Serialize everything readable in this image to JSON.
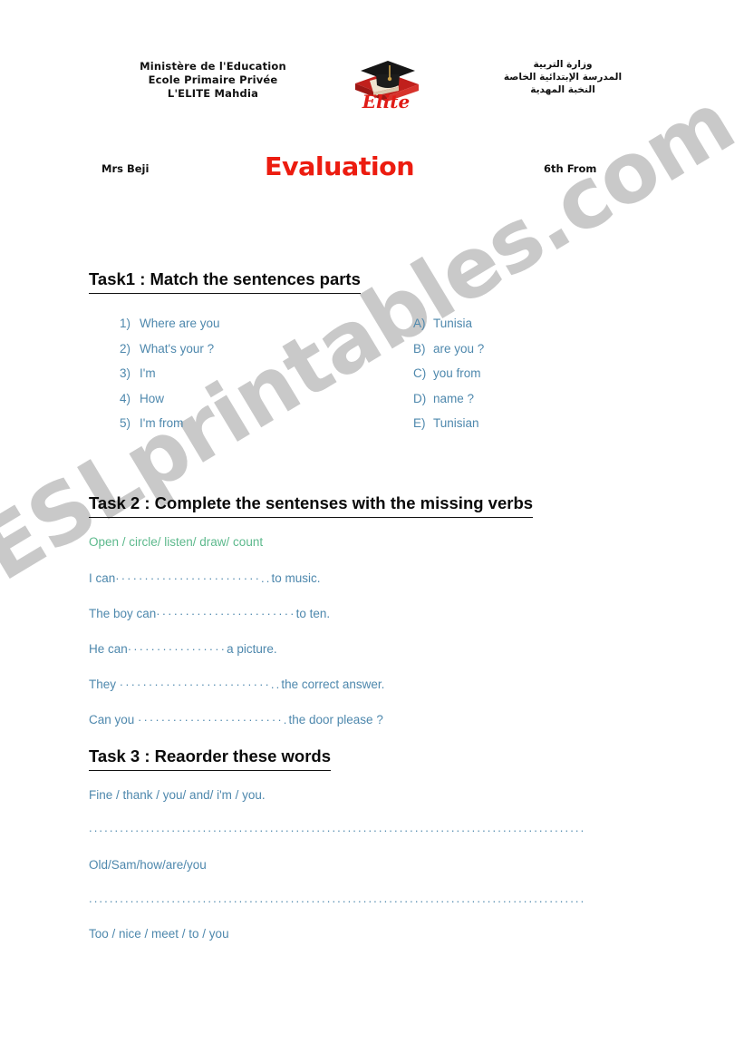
{
  "header": {
    "school_fr_lines": [
      "Ministère de l'Education",
      "Ecole Primaire Privée",
      "L'ELITE  Mahdia"
    ],
    "school_ar_lines": [
      "وزارة التربية",
      "المدرسة الإبتدائية الخاصة",
      "النخبة المهدية"
    ],
    "logo_text": "Elite",
    "logo_name": "elite-graduation-cap-logo"
  },
  "title_row": {
    "teacher": "Mrs Beji",
    "title": "Evaluation",
    "form": "6th From"
  },
  "task1": {
    "heading": "Task1 : Match the sentences parts",
    "left_items": [
      {
        "marker": "1)",
        "text": "Where are you"
      },
      {
        "marker": "2)",
        "text": "What's your ?"
      },
      {
        "marker": "3)",
        "text": "I'm"
      },
      {
        "marker": "4)",
        "text": "How"
      },
      {
        "marker": "5)",
        "text": "I'm from"
      }
    ],
    "right_items": [
      {
        "marker": "A)",
        "text": "Tunisia"
      },
      {
        "marker": "B)",
        "text": "are you ?"
      },
      {
        "marker": "C)",
        "text": "you from"
      },
      {
        "marker": "D)",
        "text": "name ?"
      },
      {
        "marker": "E)",
        "text": "Tunisian"
      }
    ]
  },
  "task2": {
    "heading": "Task 2 : Complete the sentenses with the missing verbs",
    "word_bank": "Open / circle/ listen/ draw/ count",
    "lines": [
      {
        "before": "I can",
        "dots": "·························..",
        "after": "to music."
      },
      {
        "before": "The  boy can",
        "dots": "························",
        "after": "to ten."
      },
      {
        "before": "He can",
        "dots": "·················",
        "after": "a picture."
      },
      {
        "before": "They ",
        "dots": "··························..",
        "after": "the correct answer."
      },
      {
        "before": "Can you ",
        "dots": "·························.",
        "after": "the door please ?"
      }
    ]
  },
  "task3": {
    "heading": "Task 3 : Reaorder these words",
    "prompts": [
      "Fine /  thank / you/ and/ i'm / you.",
      "Old/Sam/how/are/you",
      " Too / nice / meet / to / you"
    ],
    "blanks": [
      "............................................................................................................",
      ".........................................................................................................",
      ""
    ]
  },
  "watermark": {
    "text": "ESLprintables.com",
    "color": "#c9c9c9"
  },
  "colors": {
    "accent_red": "#ec1c10",
    "body_blue": "#4e88ad",
    "word_bank_green": "#5cb98c",
    "heading_black": "#0a0a0a"
  }
}
